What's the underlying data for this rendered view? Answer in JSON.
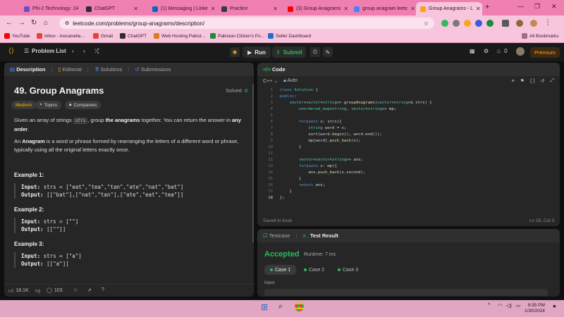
{
  "browser": {
    "tabs": [
      {
        "title": "Phi-2 Technology: 24",
        "favicon_color": "#6b4fbf"
      },
      {
        "title": "ChatGPT",
        "favicon_color": "#2d2d2d"
      },
      {
        "title": "(1) Messaging | Linke",
        "favicon_color": "#0a66c2"
      },
      {
        "title": "Practice",
        "favicon_color": "#3a3a3a"
      },
      {
        "title": "(3) Group Anagrams",
        "favicon_color": "#ff0000"
      },
      {
        "title": "group anagram leetc",
        "favicon_color": "#4285f4"
      },
      {
        "title": "Group Anagrams - L",
        "favicon_color": "#ffa116"
      }
    ],
    "active_tab_index": 6,
    "url": "leetcode.com/problems/group-anagrams/description/",
    "bookmarks": [
      {
        "label": "YouTube",
        "color": "#ff0000"
      },
      {
        "label": "Inbox - inocanahe...",
        "color": "#ea4335"
      },
      {
        "label": "Gmail",
        "color": "#ea4335"
      },
      {
        "label": "ChatGPT",
        "color": "#2d2d2d"
      },
      {
        "label": "Web Hosting Pakist...",
        "color": "#e07a1f"
      },
      {
        "label": "Pakistan Citizen's Po...",
        "color": "#1b8a3a"
      },
      {
        "label": "Seller Dashboard",
        "color": "#1f6fd1"
      }
    ],
    "all_bookmarks_label": "All Bookmarks"
  },
  "leetcode": {
    "problem_list_label": "Problem List",
    "run_label": "Run",
    "submit_label": "Submit",
    "streak_count": "0",
    "premium_label": "Premium"
  },
  "description_panel": {
    "tabs": [
      "Description",
      "Editorial",
      "Solutions",
      "Submissions"
    ],
    "title": "49. Group Anagrams",
    "solved_label": "Solved",
    "difficulty": "Medium",
    "topics_label": "Topics",
    "companies_label": "Companies",
    "intro_pre": "Given an array of strings ",
    "intro_code": "strs",
    "intro_mid": ", group ",
    "intro_bold1": "the anagrams",
    "intro_mid2": " together. You can return the answer in ",
    "intro_bold2": "any order",
    "intro_end": ".",
    "anagram_bold": "Anagram",
    "anagram_rest": " is a word or phrase formed by rearranging the letters of a different word or phrase, typically using all the original letters exactly once.",
    "anagram_prefix": "An ",
    "examples": [
      {
        "label": "Example 1:",
        "input": "strs = [\"eat\",\"tea\",\"tan\",\"ate\",\"nat\",\"bat\"]",
        "output": "[[\"bat\"],[\"nat\",\"tan\"],[\"ate\",\"eat\",\"tea\"]]"
      },
      {
        "label": "Example 2:",
        "input": "strs = [\"\"]",
        "output": "[[\"\"]]"
      },
      {
        "label": "Example 3:",
        "input": "strs = [\"a\"]",
        "output": "[[\"a\"]]"
      }
    ],
    "input_label": "Input:",
    "output_label": "Output:",
    "likes": "18.1K",
    "comments": "103"
  },
  "code_panel": {
    "header": "Code",
    "language": "C++",
    "mode": "Auto",
    "lines": [
      "class Solution {",
      "public:",
      "    vector<vector<string>> groupAnagrams(vector<string>& strs) {",
      "        unordered_map<string, vector<string>> mp;",
      "",
      "        for(auto x: strs){",
      "            string word = x;",
      "            sort(word.begin(), word.end());",
      "            mp[word].push_back(x);",
      "        }",
      "",
      "        vector<vector<string>> ans;",
      "        for(auto x: mp){",
      "            ans.push_back(x.second);",
      "        }",
      "        return ans;",
      "    }",
      "};"
    ],
    "current_line": 18,
    "saved_label": "Saved to local",
    "cursor_pos": "Ln 18, Col 3"
  },
  "test_panel": {
    "tab_testcase": "Testcase",
    "tab_result": "Test Result",
    "status": "Accepted",
    "runtime": "Runtime: 7 ms",
    "cases": [
      "Case 1",
      "Case 2",
      "Case 3"
    ],
    "input_label": "Input"
  },
  "taskbar": {
    "time": "9:35 PM",
    "date": "1/30/2024"
  }
}
